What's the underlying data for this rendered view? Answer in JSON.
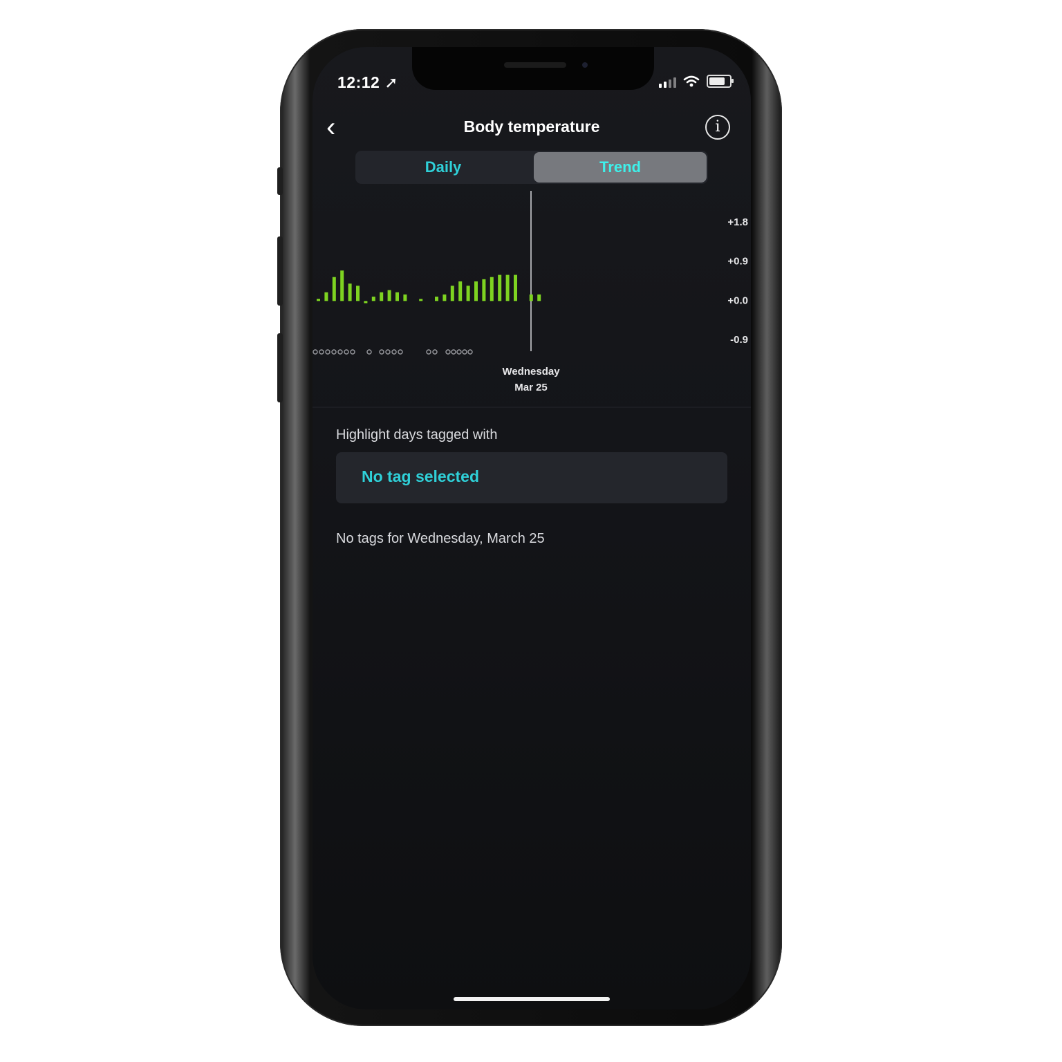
{
  "status_bar": {
    "time": "12:12 ➚"
  },
  "nav": {
    "back_icon": "‹",
    "title": "Body temperature",
    "info_icon": "i"
  },
  "tabs": [
    {
      "label": "Daily",
      "selected": false
    },
    {
      "label": "Trend",
      "selected": true
    }
  ],
  "selected_date": {
    "weekday": "Wednesday",
    "date": "Mar 25"
  },
  "highlight": {
    "label": "Highlight days tagged with",
    "value": "No tag selected"
  },
  "tags_message": "No tags for Wednesday, March 25",
  "colors": {
    "bar": "#7ed321",
    "accent": "#2fd0d8",
    "background": "#121317"
  },
  "chart_data": {
    "type": "bar",
    "y_ticks": [
      "+1.8",
      "+0.9",
      "+0.0",
      "-0.9"
    ],
    "ylim": [
      -0.9,
      1.8
    ],
    "values": [
      0.05,
      0.2,
      0.55,
      0.7,
      0.4,
      0.35,
      -0.05,
      0.1,
      0.2,
      0.25,
      0.2,
      0.15,
      null,
      0.0,
      null,
      0.1,
      0.15,
      0.35,
      0.45,
      0.35,
      0.45,
      0.5,
      0.55,
      0.6,
      0.6,
      0.6,
      null,
      0.15,
      0.15
    ],
    "missing_markers": "o",
    "grid": false,
    "selected_index": 27
  }
}
